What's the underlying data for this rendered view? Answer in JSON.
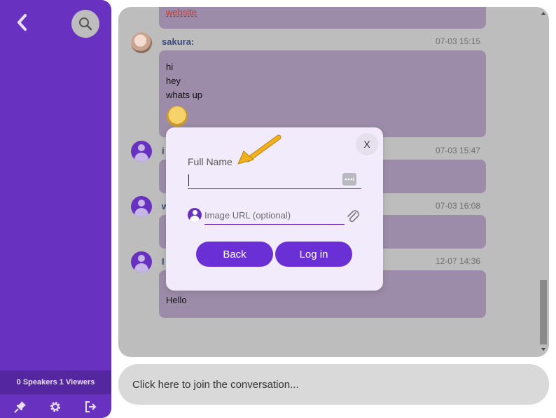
{
  "sidebar": {
    "back_icon": "chevron-left-icon",
    "search_icon": "search-icon",
    "stats": "0 Speakers 1 Viewers",
    "footer_icons": [
      "pin-icon",
      "gear-icon",
      "exit-icon"
    ]
  },
  "chat": {
    "top_link": "website",
    "messages": [
      {
        "name": "sakura:",
        "time": "07-03 15:15",
        "lines": [
          "hi",
          "hey",
          "whats up"
        ]
      },
      {
        "name": "i",
        "time": "07-03 15:47"
      },
      {
        "name": "w",
        "time": "07-03 16:08"
      },
      {
        "name": "I",
        "time": "12-07 14:36",
        "lines": [
          "Hello"
        ]
      }
    ]
  },
  "join_bar": {
    "text": "Click here to join the conversation..."
  },
  "modal": {
    "close_label": "X",
    "full_name_label": "Full Name",
    "full_name_value": "",
    "image_url_placeholder": "Image URL (optional)",
    "back_label": "Back",
    "login_label": "Log in"
  },
  "colors": {
    "sidebar": "#6931c0",
    "accent_button": "#6b2fd6",
    "bubble": "#9d8ca9",
    "annotation_arrow": "#f2b01e"
  }
}
